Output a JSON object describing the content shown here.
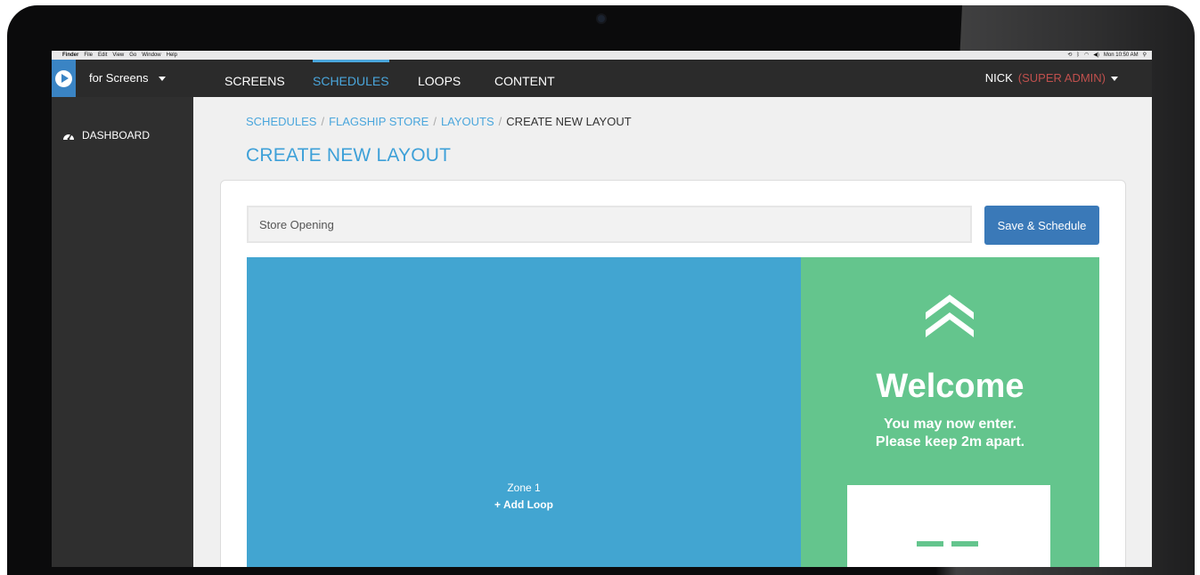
{
  "mac_menubar": {
    "left": [
      "Finder",
      "File",
      "Edit",
      "View",
      "Go",
      "Window",
      "Help"
    ],
    "clock": "Mon 10:50 AM"
  },
  "navbar": {
    "brand": "for Screens",
    "tabs": [
      {
        "label": "SCREENS",
        "active": false
      },
      {
        "label": "SCHEDULES",
        "active": true
      },
      {
        "label": "LOOPS",
        "active": false
      },
      {
        "label": "CONTENT",
        "active": false
      }
    ],
    "user_name": "NICK",
    "user_role": "(SUPER ADMIN)"
  },
  "sidebar": {
    "items": [
      {
        "label": "DASHBOARD",
        "icon": "dashboard-gauge-icon"
      }
    ]
  },
  "breadcrumb": [
    "SCHEDULES",
    "FLAGSHIP STORE",
    "LAYOUTS",
    "CREATE NEW LAYOUT"
  ],
  "page_title": "CREATE NEW LAYOUT",
  "layout_form": {
    "name_value": "Store Opening",
    "save_label": "Save & Schedule"
  },
  "zones": [
    {
      "label": "Zone 1",
      "action": "+ Add Loop",
      "color": "#42a5d1"
    },
    {
      "color": "#64c58d",
      "heading": "Welcome",
      "lines": [
        "You may now enter.",
        "Please keep 2m apart."
      ]
    }
  ],
  "colors": {
    "accent": "#4aa6dc",
    "primary_button": "#3a79b8",
    "admin_role": "#c0504d"
  }
}
